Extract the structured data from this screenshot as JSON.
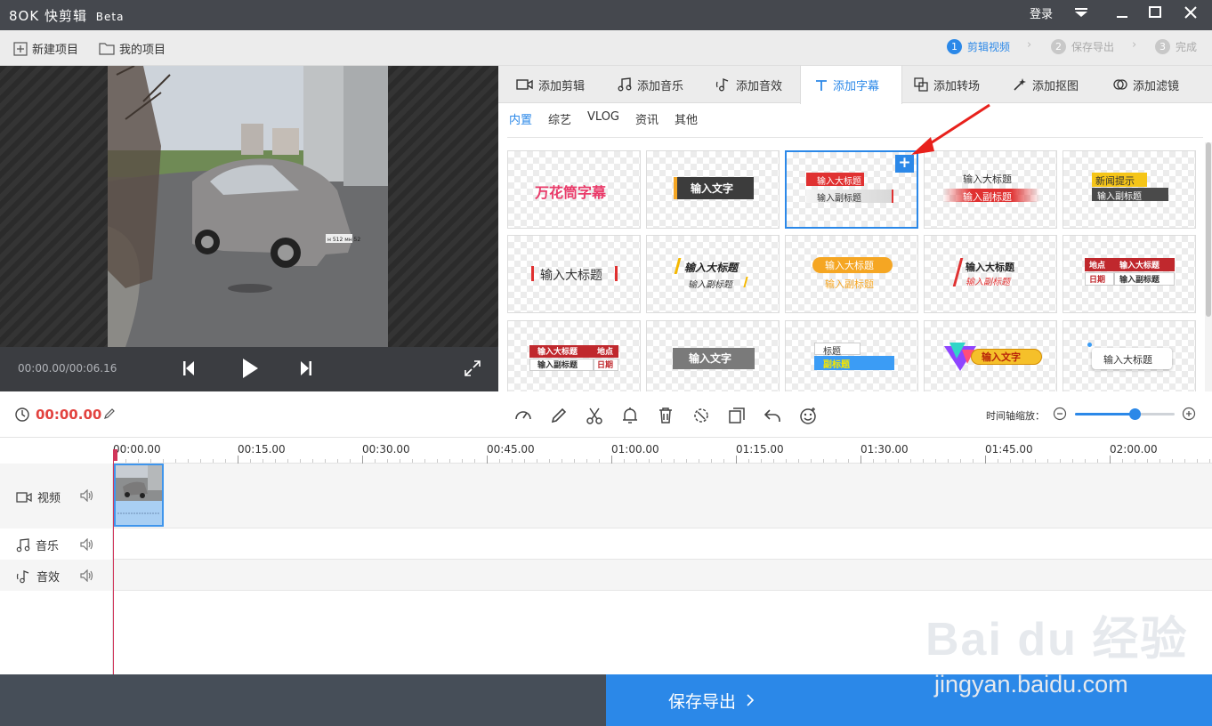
{
  "app": {
    "name": "快剪辑",
    "beta": "Beta",
    "logo": "8OK"
  },
  "window": {
    "login": "登录"
  },
  "toolbar": {
    "new_project": "新建项目",
    "my_projects": "我的项目"
  },
  "steps": [
    {
      "num": "1",
      "label": "剪辑视频"
    },
    {
      "num": "2",
      "label": "保存导出"
    },
    {
      "num": "3",
      "label": "完成"
    }
  ],
  "player": {
    "time": "00:00.00/00:06.16",
    "plate": "н 512 мн 52"
  },
  "tabs": [
    {
      "label": "添加剪辑",
      "icon": "video-icon"
    },
    {
      "label": "添加音乐",
      "icon": "music-icon"
    },
    {
      "label": "添加音效",
      "icon": "sound-effect-icon"
    },
    {
      "label": "添加字幕",
      "icon": "text-icon"
    },
    {
      "label": "添加转场",
      "icon": "transition-icon"
    },
    {
      "label": "添加抠图",
      "icon": "magic-wand-icon"
    },
    {
      "label": "添加滤镜",
      "icon": "filter-icon"
    }
  ],
  "subtabs": [
    "内置",
    "综艺",
    "VLOG",
    "资讯",
    "其他"
  ],
  "subtitle_templates": {
    "t1": "万花筒字幕",
    "t2": "输入文字",
    "t3_title": "输入大标题",
    "t3_sub": "输入副标题",
    "add": "+",
    "t4_title": "输入大标题",
    "t4_sub": "输入副标题",
    "t5_title": "新闻提示",
    "t5_sub": "输入副标题",
    "t6": "输入大标题",
    "t7_title": "输入大标题",
    "t7_sub": "输入副标题",
    "t8_title": "输入大标题",
    "t8_sub": "输入副标题",
    "t9_title": "输入大标题",
    "t9_sub": "输入副标题",
    "t10_a": "地点",
    "t10_b": "输入大标题",
    "t10_c": "日期",
    "t10_d": "输入副标题",
    "t11_a": "输入大标题",
    "t11_b": "地点",
    "t11_c": "输入副标题",
    "t11_d": "日期",
    "t12": "输入文字",
    "t13_title": "标题",
    "t13_sub": "副标题",
    "t14": "输入文字",
    "t15": "输入大标题"
  },
  "edit_bar": {
    "current_time": "00:00.00",
    "zoom_label": "时间轴缩放：",
    "zoom_level": 0.6
  },
  "timeline": {
    "ticks": [
      "00:00.00",
      "00:15.00",
      "00:30.00",
      "00:45.00",
      "01:00.00",
      "01:15.00",
      "01:30.00",
      "01:45.00",
      "02:00.00"
    ],
    "tracks": {
      "video": "视频",
      "music": "音乐",
      "sfx": "音效"
    }
  },
  "footer": {
    "export": "保存导出"
  },
  "watermark": {
    "text": "jingyan.baidu.com",
    "logo": "Bai du 经验"
  },
  "colors": {
    "accent": "#2b88e8",
    "title_bar": "#45484e",
    "time_red": "#e2433f",
    "footer": "#464e58"
  }
}
